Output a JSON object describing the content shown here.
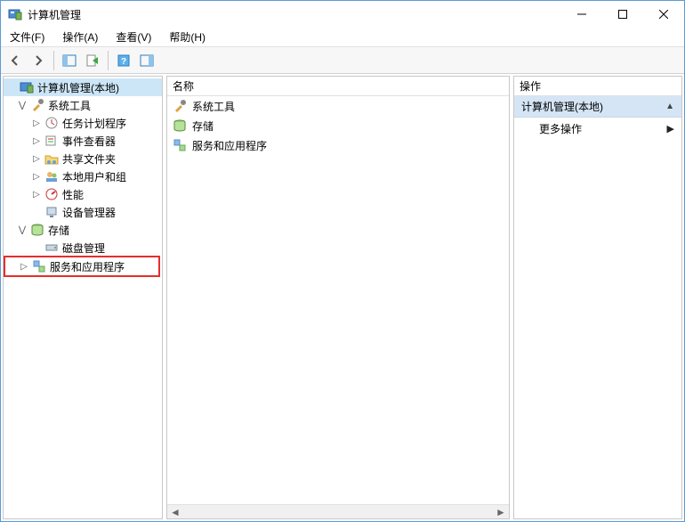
{
  "window": {
    "title": "计算机管理"
  },
  "menu": {
    "file": "文件(F)",
    "action": "操作(A)",
    "view": "查看(V)",
    "help": "帮助(H)"
  },
  "tree": {
    "root": "计算机管理(本地)",
    "system_tools": "系统工具",
    "task_scheduler": "任务计划程序",
    "event_viewer": "事件查看器",
    "shared_folders": "共享文件夹",
    "local_users_groups": "本地用户和组",
    "performance": "性能",
    "device_manager": "设备管理器",
    "storage": "存储",
    "disk_management": "磁盘管理",
    "services_apps": "服务和应用程序"
  },
  "list": {
    "header": "名称",
    "items": [
      "系统工具",
      "存储",
      "服务和应用程序"
    ]
  },
  "actions": {
    "header": "操作",
    "section_title": "计算机管理(本地)",
    "more_actions": "更多操作"
  }
}
